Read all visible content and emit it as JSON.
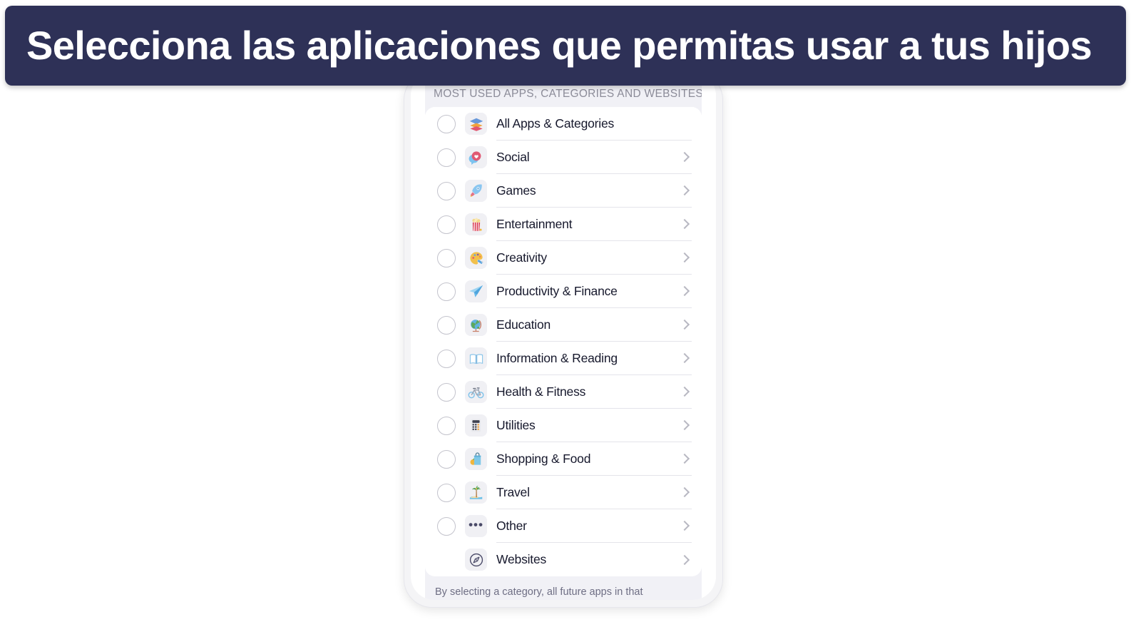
{
  "banner": {
    "text": "Selecciona las aplicaciones que permitas usar a tus hijos",
    "background_color": "#2e3157",
    "text_color": "#ffffff"
  },
  "device": {
    "screen_background_color": "#f1f1f6",
    "card_background_color": "#ffffff"
  },
  "screen": {
    "section_header": "MOST USED APPS, CATEGORIES AND WEBSITES",
    "footer_note": "By selecting a category, all future apps in that",
    "rows": [
      {
        "label": "All Apps & Categories",
        "icon": "stack-icon",
        "has_radio": true,
        "has_chevron": false
      },
      {
        "label": "Social",
        "icon": "chat-heart-icon",
        "has_radio": true,
        "has_chevron": true
      },
      {
        "label": "Games",
        "icon": "rocket-icon",
        "has_radio": true,
        "has_chevron": true
      },
      {
        "label": "Entertainment",
        "icon": "popcorn-icon",
        "has_radio": true,
        "has_chevron": true
      },
      {
        "label": "Creativity",
        "icon": "palette-icon",
        "has_radio": true,
        "has_chevron": true
      },
      {
        "label": "Productivity & Finance",
        "icon": "paper-plane-icon",
        "has_radio": true,
        "has_chevron": true
      },
      {
        "label": "Education",
        "icon": "globe-icon",
        "has_radio": true,
        "has_chevron": true
      },
      {
        "label": "Information & Reading",
        "icon": "open-book-icon",
        "has_radio": true,
        "has_chevron": true
      },
      {
        "label": "Health & Fitness",
        "icon": "bicycle-icon",
        "has_radio": true,
        "has_chevron": true
      },
      {
        "label": "Utilities",
        "icon": "calculator-icon",
        "has_radio": true,
        "has_chevron": true
      },
      {
        "label": "Shopping & Food",
        "icon": "shopping-bag-icon",
        "has_radio": true,
        "has_chevron": true
      },
      {
        "label": "Travel",
        "icon": "palm-beach-icon",
        "has_radio": true,
        "has_chevron": true
      },
      {
        "label": "Other",
        "icon": "ellipsis-icon",
        "has_radio": true,
        "has_chevron": true
      },
      {
        "label": "Websites",
        "icon": "compass-icon",
        "has_radio": false,
        "has_chevron": true
      }
    ]
  },
  "colors": {
    "radio_border": "#c3c3cc",
    "chevron": "#b8b8c2",
    "divider": "#e4e4ea",
    "label_text": "#16182c",
    "header_text": "#8c8c99",
    "icon_tile": "#f0f0f4"
  }
}
